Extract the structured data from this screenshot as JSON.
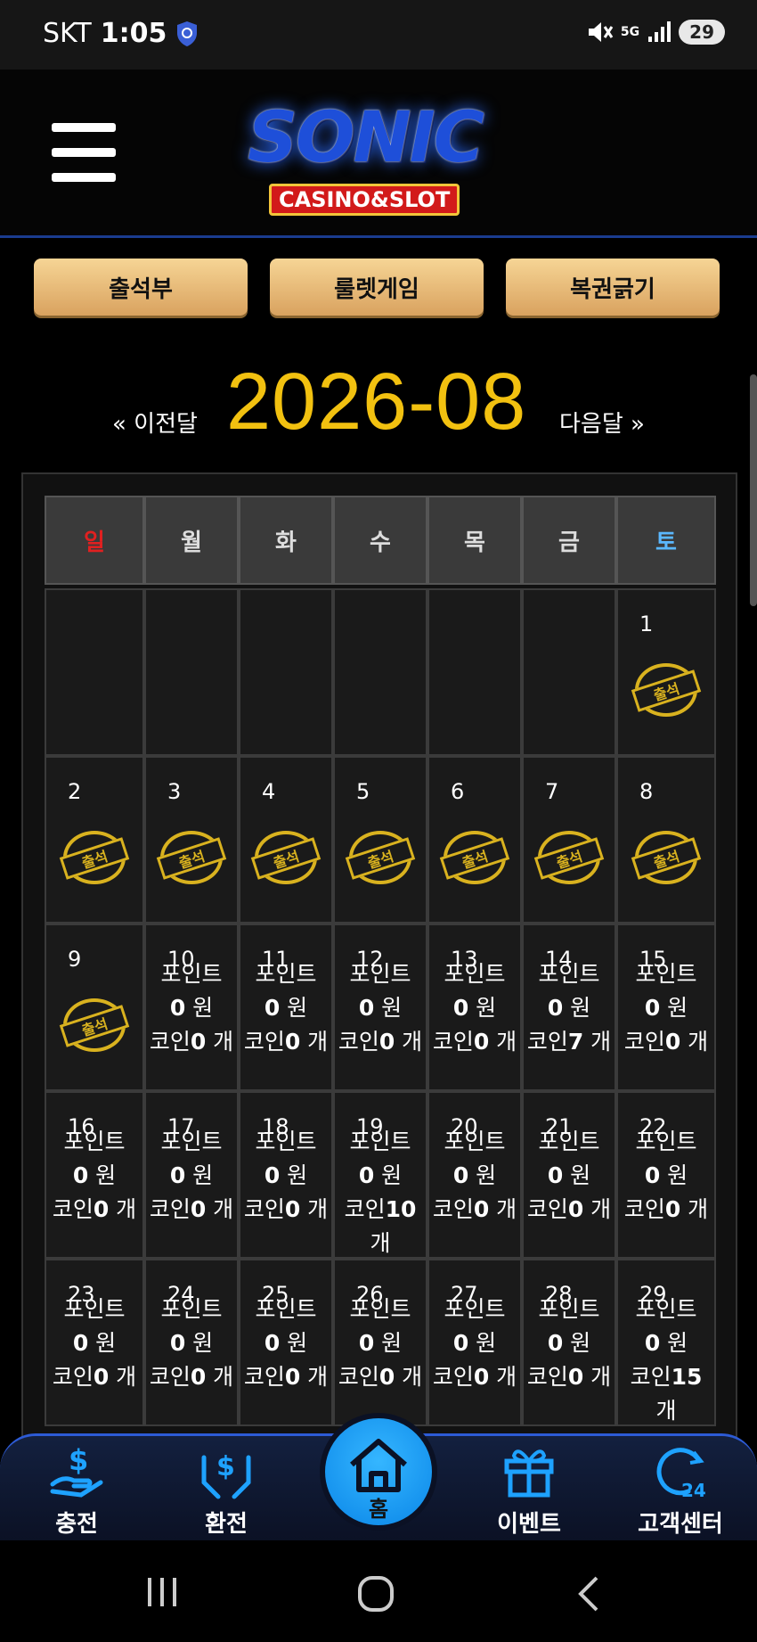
{
  "status_bar": {
    "carrier": "SKT",
    "time": "1:05",
    "network": "5G",
    "battery": "29"
  },
  "header": {
    "logo_main": "SONIC",
    "logo_sub": "CASINO&SLOT"
  },
  "actions": [
    {
      "label": "출석부"
    },
    {
      "label": "룰렛게임"
    },
    {
      "label": "복권긁기"
    }
  ],
  "month_nav": {
    "prev": "« 이전달",
    "title": "2026-08",
    "next": "다음달 »"
  },
  "calendar": {
    "weekdays": [
      "일",
      "월",
      "화",
      "수",
      "목",
      "금",
      "토"
    ],
    "weekday_colors": {
      "sun": "#e02020",
      "sat": "#5bb8ff",
      "default": "#dddddd"
    },
    "stamp_text": "출석",
    "point_label": "포인트",
    "coin_label": "코인",
    "won_unit": "원",
    "count_unit": "개",
    "weeks": [
      [
        {
          "day": ""
        },
        {
          "day": ""
        },
        {
          "day": ""
        },
        {
          "day": ""
        },
        {
          "day": ""
        },
        {
          "day": ""
        },
        {
          "day": "1",
          "attended": true
        }
      ],
      [
        {
          "day": "2",
          "attended": true
        },
        {
          "day": "3",
          "attended": true
        },
        {
          "day": "4",
          "attended": true
        },
        {
          "day": "5",
          "attended": true
        },
        {
          "day": "6",
          "attended": true
        },
        {
          "day": "7",
          "attended": true
        },
        {
          "day": "8",
          "attended": true
        }
      ],
      [
        {
          "day": "9",
          "attended": true
        },
        {
          "day": "10",
          "points": "0",
          "coins": "0"
        },
        {
          "day": "11",
          "points": "0",
          "coins": "0"
        },
        {
          "day": "12",
          "points": "0",
          "coins": "0"
        },
        {
          "day": "13",
          "points": "0",
          "coins": "0"
        },
        {
          "day": "14",
          "points": "0",
          "coins": "7"
        },
        {
          "day": "15",
          "points": "0",
          "coins": "0"
        }
      ],
      [
        {
          "day": "16",
          "points": "0",
          "coins": "0"
        },
        {
          "day": "17",
          "points": "0",
          "coins": "0"
        },
        {
          "day": "18",
          "points": "0",
          "coins": "0"
        },
        {
          "day": "19",
          "points": "0",
          "coins": "10"
        },
        {
          "day": "20",
          "points": "0",
          "coins": "0"
        },
        {
          "day": "21",
          "points": "0",
          "coins": "0"
        },
        {
          "day": "22",
          "points": "0",
          "coins": "0"
        }
      ],
      [
        {
          "day": "23",
          "points": "0",
          "coins": "0"
        },
        {
          "day": "24",
          "points": "0",
          "coins": "0"
        },
        {
          "day": "25",
          "points": "0",
          "coins": "0"
        },
        {
          "day": "26",
          "points": "0",
          "coins": "0"
        },
        {
          "day": "27",
          "points": "0",
          "coins": "0"
        },
        {
          "day": "28",
          "points": "0",
          "coins": "0"
        },
        {
          "day": "29",
          "points": "0",
          "coins": "15"
        }
      ]
    ]
  },
  "bottom_nav": {
    "items": [
      {
        "label": "충전",
        "icon": "deposit-icon"
      },
      {
        "label": "환전",
        "icon": "exchange-icon"
      },
      {
        "label": "홈",
        "icon": "home-icon"
      },
      {
        "label": "이벤트",
        "icon": "gift-icon"
      },
      {
        "label": "고객센터",
        "icon": "support-24-icon"
      }
    ],
    "accent": "#1ea2ff"
  }
}
